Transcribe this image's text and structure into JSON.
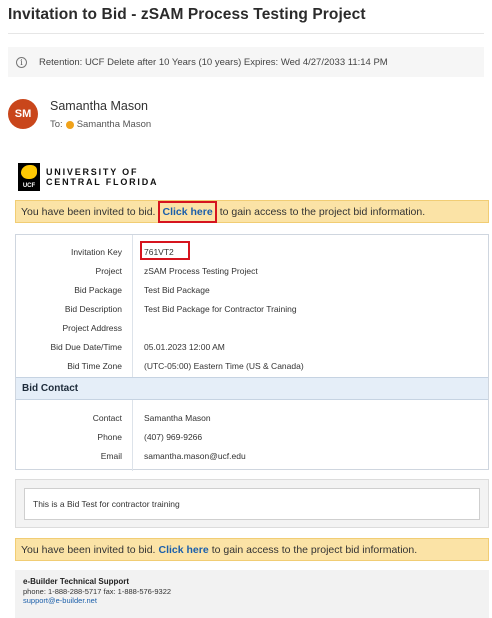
{
  "email": {
    "subject": "Invitation to Bid - zSAM Process Testing Project",
    "retention": "Retention: UCF Delete after 10 Years (10 years) Expires: Wed 4/27/2033 11:14 PM",
    "sender_initials": "SM",
    "sender_name": "Samantha Mason",
    "to_label": "To:",
    "to_name": "Samantha Mason"
  },
  "logo": {
    "mark_text": "UCF",
    "line1": "UNIVERSITY OF",
    "line2": "CENTRAL FLORIDA"
  },
  "banner_top": {
    "prefix": "You have been invited to bid.",
    "link": "Click here",
    "suffix": "to gain access to the project bid information."
  },
  "details": {
    "rows": [
      {
        "label": "Invitation Key",
        "value": "761VT2"
      },
      {
        "label": "Project",
        "value": "zSAM Process Testing Project"
      },
      {
        "label": "Bid Package",
        "value": "Test Bid Package"
      },
      {
        "label": "Bid Description",
        "value": "Test Bid Package for Contractor Training"
      },
      {
        "label": "Project Address",
        "value": ""
      },
      {
        "label": "Bid Due Date/Time",
        "value": "05.01.2023 12:00 AM"
      },
      {
        "label": "Bid Time Zone",
        "value": "(UTC-05:00) Eastern Time (US & Canada)"
      }
    ],
    "contact_heading": "Bid Contact",
    "contact_rows": [
      {
        "label": "Contact",
        "value": "Samantha Mason"
      },
      {
        "label": "Phone",
        "value": "(407) 969-9266"
      },
      {
        "label": "Email",
        "value": "samantha.mason@ucf.edu"
      }
    ]
  },
  "note": "This is a Bid Test for contractor training",
  "banner_bottom": {
    "prefix": "You have been invited to bid.",
    "link": "Click here",
    "suffix": "to gain access to the project bid information."
  },
  "support": {
    "title": "e-Builder Technical Support",
    "phones": "phone: 1-888-288-5717 fax: 1-888-576-9322",
    "email": "support@e-builder.net"
  },
  "colors": {
    "banner_bg": "#fbe3a6",
    "link": "#1b5faa",
    "highlight_box": "#d6141e",
    "avatar": "#c9461b",
    "section_head": "#e5eef8"
  }
}
